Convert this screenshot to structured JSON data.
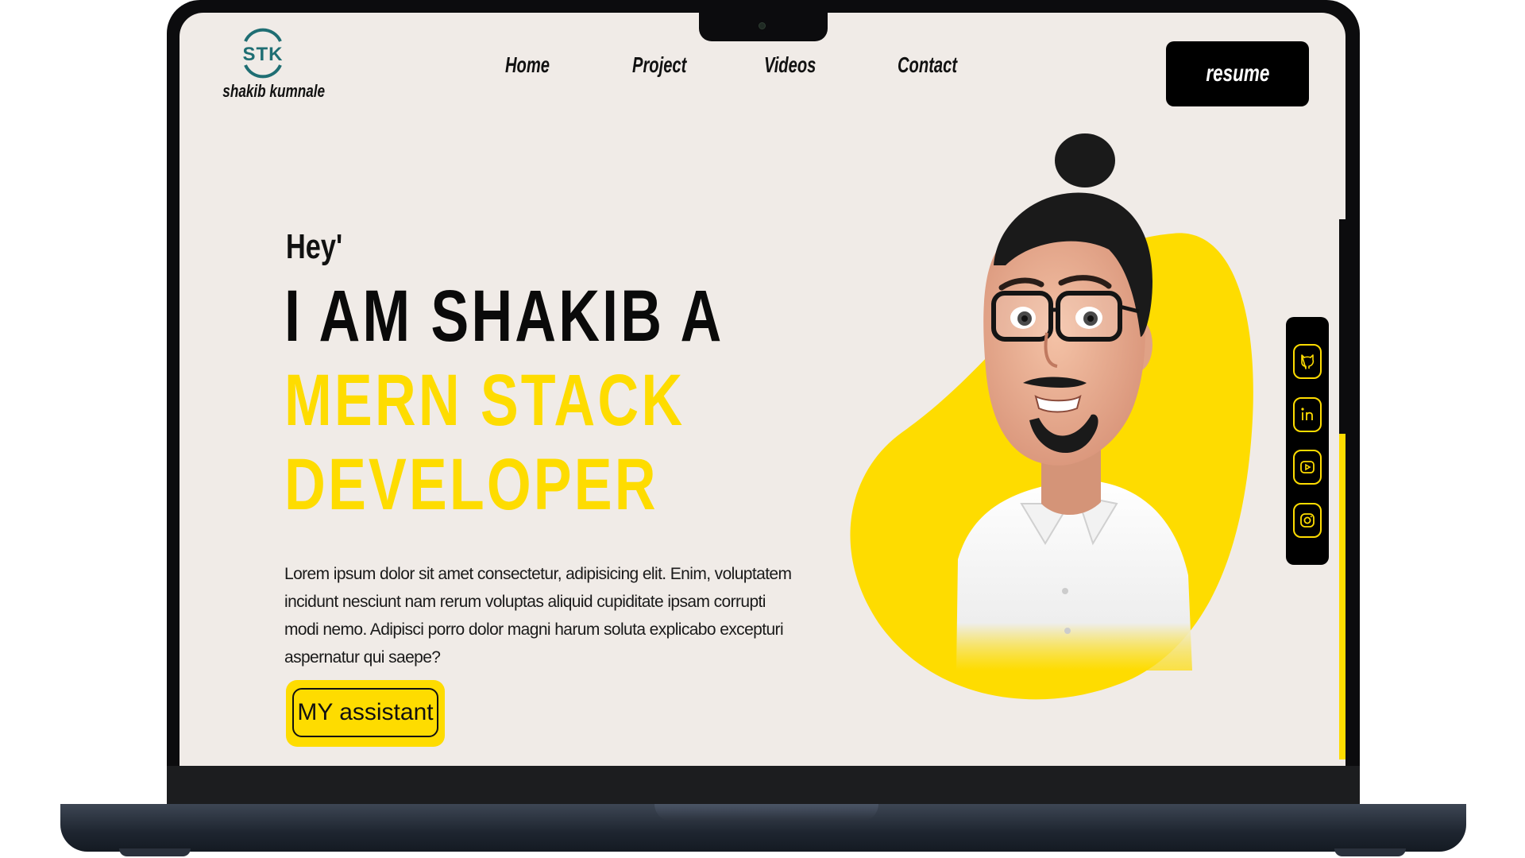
{
  "logo": {
    "mark_text": "STK",
    "name": "shakib kumnale",
    "accent_color": "#1f6e73"
  },
  "nav": {
    "items": [
      {
        "label": "Home"
      },
      {
        "label": "Project"
      },
      {
        "label": "Videos"
      },
      {
        "label": "Contact"
      }
    ],
    "resume_label": "resume"
  },
  "hero": {
    "greeting": "Hey'",
    "line1": "I AM SHAKIB A",
    "line2": "MERN STACK",
    "line3": "DEVELOPER",
    "description": "Lorem ipsum dolor sit amet consectetur, adipisicing elit. Enim, voluptatem incidunt nesciunt nam rerum voluptas aliquid cupiditate ipsam corrupti modi nemo. Adipisci porro dolor magni harum soluta explicabo excepturi aspernatur qui saepe?",
    "cta_label": "MY assistant"
  },
  "social": {
    "icons": [
      "github-icon",
      "linkedin-icon",
      "youtube-icon",
      "instagram-icon"
    ]
  },
  "colors": {
    "accent_yellow": "#fedc00",
    "background": "#f0ebe7",
    "text_dark": "#111111"
  }
}
